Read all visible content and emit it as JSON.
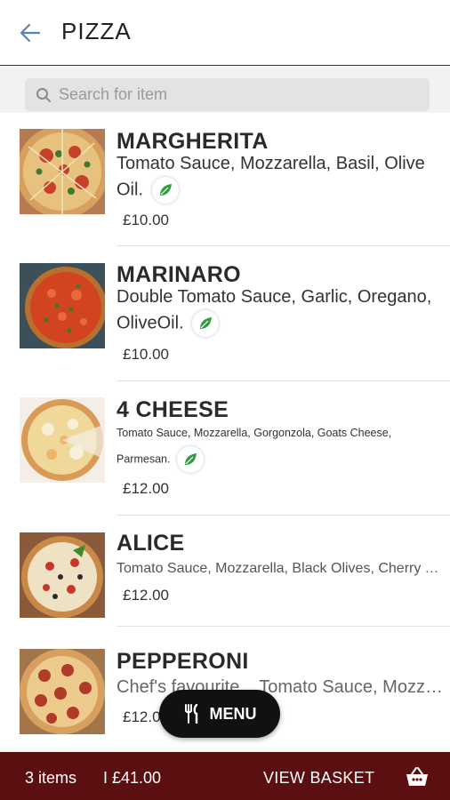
{
  "header": {
    "title": "PIZZA",
    "back_icon": "arrow-left-icon"
  },
  "search": {
    "placeholder": "Search for item",
    "icon": "search-icon"
  },
  "items": [
    {
      "name": "MARGHERITA",
      "description": "Tomato Sauce, Mozzarella, Basil, Olive Oil.",
      "price": "£10.00",
      "vegetarian": true
    },
    {
      "name": "MARINARO",
      "description": "Double Tomato Sauce, Garlic, Oregano, OliveOil.",
      "price": "£10.00",
      "vegetarian": true
    },
    {
      "name": "4 CHEESE",
      "description": "Tomato Sauce, Mozzarella, Gorgonzola, Goats Cheese, Parmesan.",
      "price": "£12.00",
      "vegetarian": true
    },
    {
      "name": "ALICE",
      "description": "Tomato Sauce, Mozzarella, Black Olives, Cherry Tomatoes...",
      "price": "£12.00",
      "vegetarian": false
    },
    {
      "name": "PEPPERONI",
      "description": "Chef's favourite.., Tomato Sauce, Mozzarella, Pepperoni...",
      "price": "£12.00",
      "vegetarian": false
    }
  ],
  "menu_button": {
    "label": "MENU",
    "icon": "cutlery-icon"
  },
  "footer": {
    "items_count": "3 items",
    "total": "I £41.00",
    "view_basket": "VIEW BASKET",
    "basket_icon": "basket-icon"
  },
  "colors": {
    "footer_bg": "#5b0f10",
    "leaf_green": "#2e9e3e",
    "menu_button_bg": "#111111"
  }
}
